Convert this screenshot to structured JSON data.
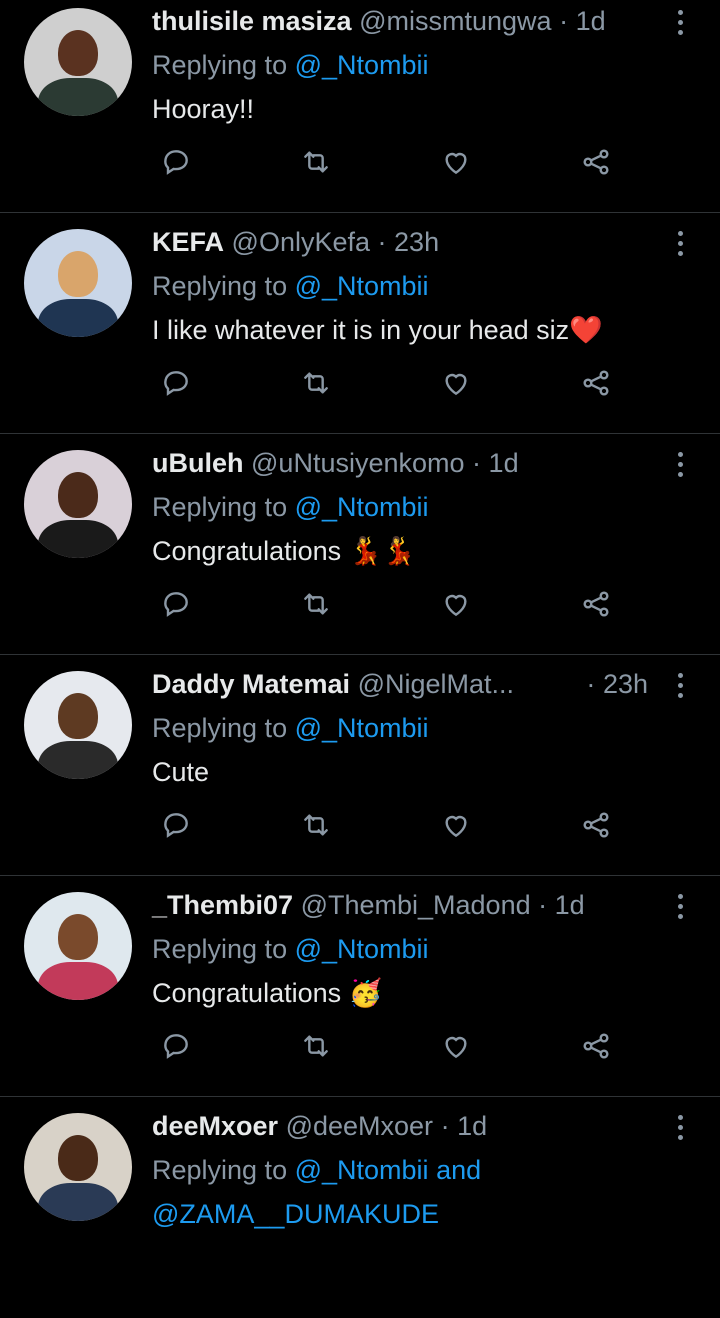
{
  "tweets": [
    {
      "name": "thulisile masiza",
      "handle": "@missmtungwa",
      "sep": "·",
      "time": "1d",
      "replying_prefix": "Replying to",
      "replying_to": "@_Ntombii",
      "text": "Hooray!!",
      "emoji": "",
      "avatar_bg": "#cfcfcf",
      "avatar_skin": "#5a3220",
      "avatar_cloth": "#2b3a33"
    },
    {
      "name": "KEFA",
      "handle": "@OnlyKefa",
      "sep": "·",
      "time": "23h",
      "replying_prefix": "Replying to",
      "replying_to": "@_Ntombii",
      "text": "I like whatever it is in your head siz",
      "emoji": "❤️",
      "avatar_bg": "#c9d6e8",
      "avatar_skin": "#d9a56b",
      "avatar_cloth": "#1f3552"
    },
    {
      "name": "uBuleh",
      "handle": "@uNtusiyenkomo",
      "sep": "·",
      "time": "1d",
      "replying_prefix": "Replying to",
      "replying_to": "@_Ntombii",
      "text": "Congratulations ",
      "emoji": "💃💃",
      "avatar_bg": "#d9d0d8",
      "avatar_skin": "#4b2a1a",
      "avatar_cloth": "#1a1a1a"
    },
    {
      "name": "Daddy Matemai",
      "handle": "@NigelMat...",
      "sep": "·",
      "time": "23h",
      "replying_prefix": "Replying to",
      "replying_to": "@_Ntombii",
      "text": "Cute",
      "emoji": "",
      "avatar_bg": "#e6e9ee",
      "avatar_skin": "#5e3a22",
      "avatar_cloth": "#2a2a2a"
    },
    {
      "name": "_Thembi07",
      "handle": "@Thembi_Madond",
      "sep": "·",
      "time": "1d",
      "replying_prefix": "Replying to",
      "replying_to": "@_Ntombii",
      "text": "Congratulations ",
      "emoji": "🥳",
      "avatar_bg": "#dfe8ee",
      "avatar_skin": "#7a4a2c",
      "avatar_cloth": "#c23a5a"
    },
    {
      "name": "deeMxoer",
      "handle": "@deeMxoer",
      "sep": "·",
      "time": "1d",
      "replying_prefix": "Replying to",
      "replying_to": "@_Ntombii",
      "replying_and": "and",
      "replying_to_2": "@ZAMA__DUMAKUDE",
      "text": "",
      "emoji": "",
      "avatar_bg": "#d8d2c8",
      "avatar_skin": "#4a2a18",
      "avatar_cloth": "#2a3a55"
    }
  ],
  "icons": {
    "reply": "reply-icon",
    "retweet": "retweet-icon",
    "like": "heart-icon",
    "share": "share-icon",
    "more": "more-options-icon"
  },
  "colors": {
    "background": "#000000",
    "text": "#e7e9ea",
    "secondary": "#8b98a5",
    "link": "#1d9bf0",
    "divider": "#2f3336"
  }
}
